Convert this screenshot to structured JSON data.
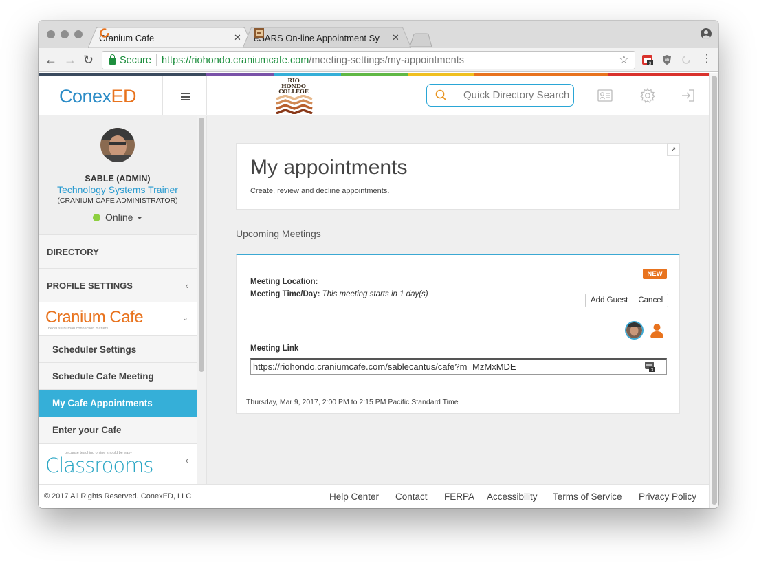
{
  "browser": {
    "tabs": [
      {
        "title": "Cranium Cafe",
        "close": "✕"
      },
      {
        "title": "eSARS On-line Appointment Sy",
        "close": "✕"
      }
    ],
    "omnibox": {
      "secure_label": "Secure",
      "url_scheme_host": "https://riohondo.craniumcafe.com",
      "url_path": "/meeting-settings/my-appointments"
    },
    "extension_badge": "3"
  },
  "header": {
    "logo_conex": "Conex",
    "logo_ed": "ED",
    "college_name": [
      "RIO",
      "HONDO",
      "COLLEGE"
    ],
    "search_placeholder": "Quick Directory Search"
  },
  "colors": {
    "brand_blue": "#2a8bc6",
    "brand_orange": "#e8731e",
    "active_nav": "#35afd8",
    "status_online": "#8dcf3f",
    "colorbar": [
      "#3a4a5e",
      "#7a52a8",
      "#35afd8",
      "#60b845",
      "#f0c020",
      "#e8731e",
      "#d9322c"
    ]
  },
  "sidebar": {
    "profile": {
      "name": "SABLE (ADMIN)",
      "title": "Technology Systems Trainer",
      "role": "(CRANIUM CAFE ADMINISTRATOR)",
      "status": "Online"
    },
    "sections": {
      "directory": "DIRECTORY",
      "profile_settings": "PROFILE SETTINGS"
    },
    "cafe": {
      "logo": "Cranium Cafe",
      "tagline": "because human connection matters"
    },
    "items": [
      {
        "label": "Scheduler Settings"
      },
      {
        "label": "Schedule Cafe Meeting"
      },
      {
        "label": "My Cafe Appointments",
        "active": true
      },
      {
        "label": "Enter your Cafe"
      }
    ],
    "classrooms": {
      "logo": "Classrooms",
      "tagline": "because teaching online should be easy"
    }
  },
  "main": {
    "title": "My appointments",
    "subtitle": "Create, review and decline appointments.",
    "section_label": "Upcoming Meetings",
    "meeting": {
      "badge": "NEW",
      "location_label": "Meeting Location:",
      "time_label": "Meeting Time/Day:",
      "time_value": "This meeting starts in 1 day(s)",
      "add_guest": "Add Guest",
      "cancel": "Cancel",
      "link_label": "Meeting Link",
      "link_value": "https://riohondo.craniumcafe.com/sablecantus/cafe?m=MzMxMDE=",
      "datetime": "Thursday, Mar 9, 2017, 2:00 PM to 2:15 PM Pacific Standard Time"
    }
  },
  "footer": {
    "copyright": "© 2017 All Rights Reserved. ConexED, LLC",
    "links": [
      "Help Center",
      "Contact",
      "FERPA",
      "Accessibility",
      "Terms of Service",
      "Privacy Policy"
    ]
  }
}
